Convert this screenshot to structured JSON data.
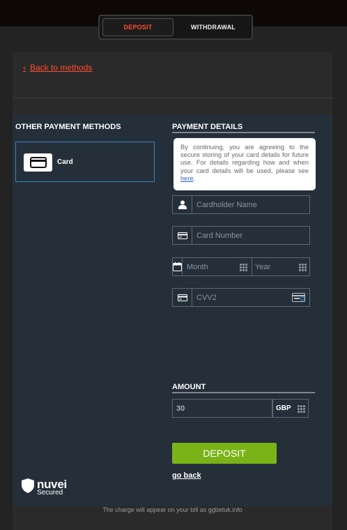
{
  "tabs": {
    "deposit_label": "DEPOSIT",
    "withdrawal_label": "WITHDRAWAL"
  },
  "back_label": "Back to methods",
  "other_methods": {
    "title": "OTHER PAYMENT METHODS",
    "items": [
      {
        "label": "Card",
        "icon": "credit-card-icon"
      }
    ]
  },
  "payment_details": {
    "title": "PAYMENT DETAILS",
    "notice_text": "By continuing, you are agreeing to the secure storing of your card details for future use. For details regarding how and when your card details will be used, please see ",
    "notice_link": "here",
    "notice_end": ".",
    "cardholder_placeholder": "Cardholder Name",
    "card_number_placeholder": "Card Number",
    "month_placeholder": "Month",
    "year_placeholder": "Year",
    "cvv_placeholder": "CVV2"
  },
  "amount": {
    "title": "AMOUNT",
    "value": "30",
    "currency": "GBP"
  },
  "deposit_button": "DEPOSIT",
  "go_back": "go back",
  "brand": {
    "name": "nuvei",
    "subtitle": "Secured"
  },
  "footer_text": "The charge will appear on your bill as ggbetuk.info",
  "colors": {
    "accent": "#ff4d2e",
    "primary_button": "#7ab317",
    "selected_border": "#2f86c8",
    "panel": "#252f3a"
  }
}
